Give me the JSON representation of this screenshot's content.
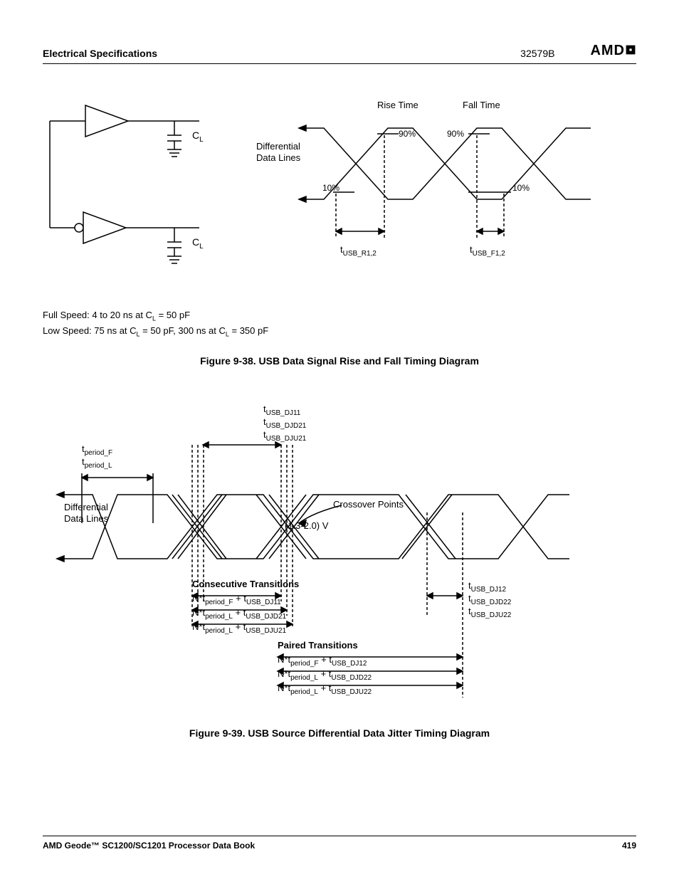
{
  "header": {
    "section": "Electrical Specifications",
    "doc_code": "32579B",
    "brand": "AMD"
  },
  "fig38": {
    "cl_top": "C",
    "cl_top_sub": "L",
    "cl_bot": "C",
    "cl_bot_sub": "L",
    "diff_label_l1": "Differential",
    "diff_label_l2": "Data Lines",
    "rise": "Rise Time",
    "fall": "Fall Time",
    "p90_a": "90%",
    "p90_b": "90%",
    "p10_a": "10%",
    "p10_b": "10%",
    "tusb_r": "USB_R1,2",
    "tusb_f": "USB_F1,2",
    "note1_a": "Full Speed: 4 to 20 ns at C",
    "note1_b": " = 50 pF",
    "note2_a": "Low Speed: 75 ns at C",
    "note2_b": " = 50 pF, 300 ns at C",
    "note2_c": " = 350 pF",
    "caption": "Figure 9-38.  USB Data Signal Rise and Fall Timing Diagram"
  },
  "fig39": {
    "top_labels": {
      "l1": "USB_DJ11",
      "l2": "USB_DJD21",
      "l3": "USB_DJU21"
    },
    "period_F": "period_F",
    "period_L": "period_L",
    "diff_l1": "Differential",
    "diff_l2": "Data Lines",
    "crossover": "Crossover Points",
    "crossover_v": "(1.3-2.0) V",
    "right_labels": {
      "l1": "USB_DJ12",
      "l2": "USB_DJD22",
      "l3": "USB_DJU22"
    },
    "consec_hdr": "Consecutive Transitions",
    "consec_1a": "N*t",
    "consec_1b": "period_F",
    "consec_1c": " + t",
    "consec_1d": "USB_DJ11",
    "consec_2a": "N*t",
    "consec_2b": "period_L",
    "consec_2c": " + t",
    "consec_2d": "USB_DJD21",
    "consec_3a": "N*t",
    "consec_3b": "period_L",
    "consec_3c": " + t",
    "consec_3d": "USB_DJU21",
    "paired_hdr": "Paired Transitions",
    "paired_1a": "N*t",
    "paired_1b": "period_F",
    "paired_1c": " + t",
    "paired_1d": "USB_DJ12",
    "paired_2a": "N*t",
    "paired_2b": "period_L",
    "paired_2c": " + t",
    "paired_2d": "USB_DJD22",
    "paired_3a": "N*t",
    "paired_3b": "period_L",
    "paired_3c": " + t",
    "paired_3d": "USB_DJU22",
    "caption": "Figure 9-39.  USB Source Differential Data Jitter Timing Diagram"
  },
  "footer": {
    "title": "AMD Geode™ SC1200/SC1201 Processor Data Book",
    "page": "419"
  }
}
